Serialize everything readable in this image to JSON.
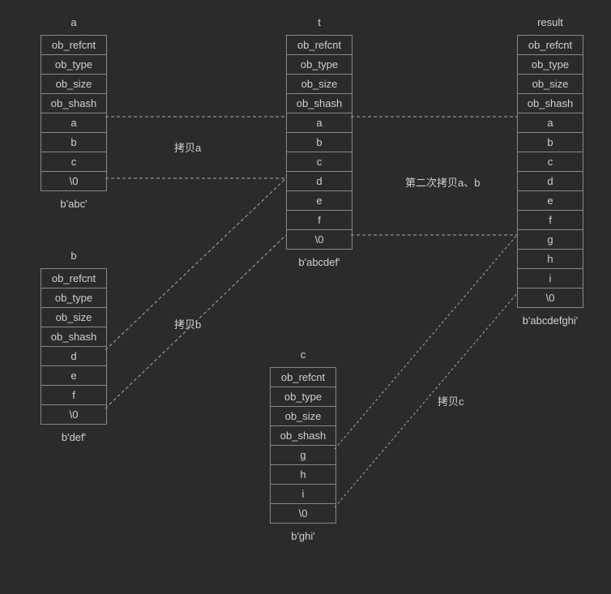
{
  "structs": {
    "a": {
      "title": "a",
      "footer": "b'abc'",
      "cells": [
        "ob_refcnt",
        "ob_type",
        "ob_size",
        "ob_shash",
        "a",
        "b",
        "c",
        "\\0"
      ]
    },
    "b": {
      "title": "b",
      "footer": "b'def'",
      "cells": [
        "ob_refcnt",
        "ob_type",
        "ob_size",
        "ob_shash",
        "d",
        "e",
        "f",
        "\\0"
      ]
    },
    "t": {
      "title": "t",
      "footer": "b'abcdef'",
      "cells": [
        "ob_refcnt",
        "ob_type",
        "ob_size",
        "ob_shash",
        "a",
        "b",
        "c",
        "d",
        "e",
        "f",
        "\\0"
      ]
    },
    "c": {
      "title": "c",
      "footer": "b'ghi'",
      "cells": [
        "ob_refcnt",
        "ob_type",
        "ob_size",
        "ob_shash",
        "g",
        "h",
        "i",
        "\\0"
      ]
    },
    "result": {
      "title": "result",
      "footer": "b'abcdefghi'",
      "cells": [
        "ob_refcnt",
        "ob_type",
        "ob_size",
        "ob_shash",
        "a",
        "b",
        "c",
        "d",
        "e",
        "f",
        "g",
        "h",
        "i",
        "\\0"
      ]
    }
  },
  "annotations": {
    "copy_a": "拷贝a",
    "copy_b": "拷贝b",
    "copy_c": "拷贝c",
    "copy_ab_second": "第二次拷贝a、b"
  }
}
